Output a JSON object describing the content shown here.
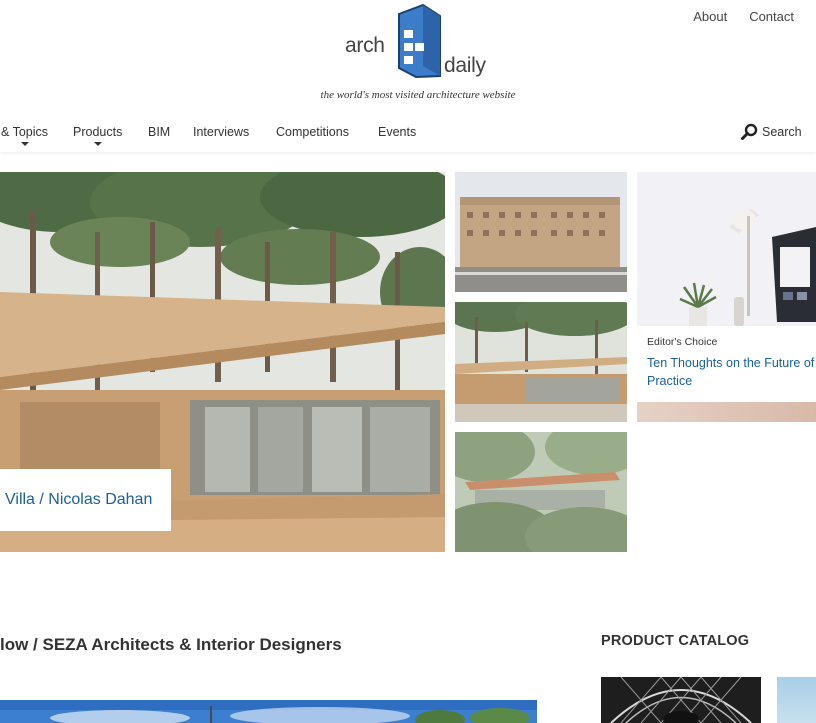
{
  "header": {
    "top_links": [
      "About",
      "Contact"
    ],
    "logo": {
      "word_left": "arch",
      "word_right": "daily"
    },
    "tagline": "the world's most visited architecture website"
  },
  "nav": {
    "items": [
      {
        "label": "& Topics",
        "has_caret": true
      },
      {
        "label": "Products",
        "has_caret": true
      },
      {
        "label": "BIM",
        "has_caret": false
      },
      {
        "label": "Interviews",
        "has_caret": false
      },
      {
        "label": "Competitions",
        "has_caret": false
      },
      {
        "label": "Events",
        "has_caret": false
      }
    ],
    "search_label": "Search"
  },
  "hero": {
    "caption": "Villa / Nicolas Dahan"
  },
  "editor_choice": {
    "label": "Editor's Choice",
    "title_line1": "Ten Thoughts on the Future of",
    "title_line2": "Practice"
  },
  "article": {
    "title": "low / SEZA Architects & Interior Designers"
  },
  "catalog": {
    "heading": "PRODUCT CATALOG"
  },
  "colors": {
    "link_blue": "#1a5f9e",
    "logo_blue": "#3d7cc9",
    "text": "#333333"
  },
  "icons": [
    "search-icon",
    "caret-down-icon",
    "archdaily-logo"
  ]
}
